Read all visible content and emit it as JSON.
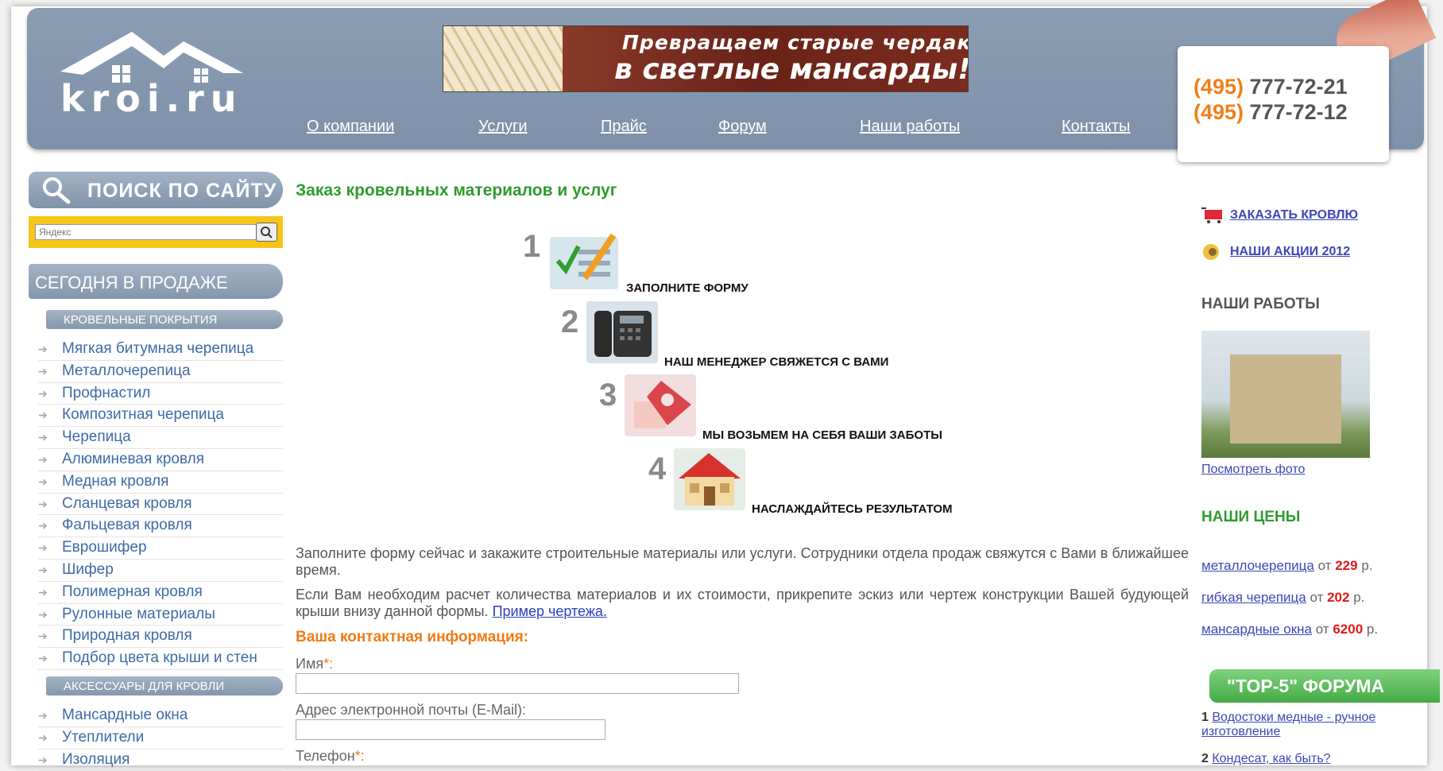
{
  "header": {
    "logo_text": "kroi.ru",
    "banner_line1": "Превращаем старые чердаки",
    "banner_line2": "в светлые мансарды!",
    "nav": [
      "О компании",
      "Услуги",
      "Прайс",
      "Форум",
      "Наши работы",
      "Контакты"
    ],
    "phones": [
      {
        "code": "(495)",
        "number": "777-72-21"
      },
      {
        "code": "(495)",
        "number": "777-72-12"
      }
    ]
  },
  "sidebar_left": {
    "search_title": "ПОИСК ПО САЙТУ",
    "search_placeholder": "Яндекс",
    "sale_title": "СЕГОДНЯ В ПРОДАЖЕ",
    "section1": "КРОВЕЛЬНЫЕ ПОКРЫТИЯ",
    "items1": [
      "Мягкая битумная черепица",
      "Металлочерепица",
      "Профнастил",
      "Композитная черепица",
      "Черепица",
      "Алюминевая кровля",
      "Медная кровля",
      "Сланцевая кровля",
      "Фальцевая кровля",
      "Еврошифер",
      "Шифер",
      "Полимерная кровля",
      "Рулонные материалы",
      "Природная кровля",
      "Подбор цвета крыши и стен"
    ],
    "section2": "АКСЕССУАРЫ ДЛЯ КРОВЛИ",
    "items2": [
      "Мансардные окна",
      "Утеплители",
      "Изоляция"
    ]
  },
  "main": {
    "title": "Заказ кровельных материалов и услуг",
    "steps": [
      {
        "num": "1",
        "caption": "ЗАПОЛНИТЕ ФОРМУ"
      },
      {
        "num": "2",
        "caption": "НАШ МЕНЕДЖЕР СВЯЖЕТСЯ С ВАМИ"
      },
      {
        "num": "3",
        "caption": "МЫ ВОЗЬМЕМ НА СЕБЯ ВАШИ ЗАБОТЫ"
      },
      {
        "num": "4",
        "caption": "НАСЛАЖДАЙТЕСЬ РЕЗУЛЬТАТОМ"
      }
    ],
    "para1": "Заполните форму сейчас и закажите строительные материалы или услуги. Сотрудники отдела продаж свяжутся с Вами в ближайшее время.",
    "para2": "Если Вам необходим расчет количества материалов и их стоимости, прикрепите эскиз или чертеж конструкции Вашей будующей крыши внизу данной формы.",
    "para2_link": "Пример чертежа.",
    "contact_heading": "Ваша контактная информация:",
    "fields": [
      {
        "label": "Имя",
        "required": "*:"
      },
      {
        "label": "Адрес электронной почты (E-Mail):",
        "required": ""
      },
      {
        "label": "Телефон",
        "required": "*:"
      }
    ]
  },
  "sidebar_right": {
    "order_link": "ЗАКАЗАТЬ КРОВЛЮ",
    "promo_link": "НАШИ АКЦИИ 2012",
    "works_heading": "НАШИ РАБОТЫ",
    "photo_link": "Посмотреть фото",
    "prices_heading": "НАШИ ЦЕНЫ",
    "prices": [
      {
        "name": "металлочерепица",
        "from": "от",
        "value": "229",
        "unit": "р."
      },
      {
        "name": "гибкая черепица",
        "from": "от",
        "value": "202",
        "unit": "р."
      },
      {
        "name": "мансардные окна",
        "from": "от",
        "value": "6200",
        "unit": "р."
      }
    ],
    "forum_title": "\"TOP-5\"  ФОРУМА",
    "forum": [
      {
        "n": "1",
        "text": "Водостоки медные - ручное изготовление"
      },
      {
        "n": "2",
        "text": "Кондесат, как быть?"
      }
    ]
  },
  "colors": {
    "accent_green": "#2e9b2e",
    "accent_orange": "#ef7b13",
    "header_blue": "#8b9db3",
    "link_blue": "#3d46b8",
    "price_red": "#e01b1b"
  }
}
